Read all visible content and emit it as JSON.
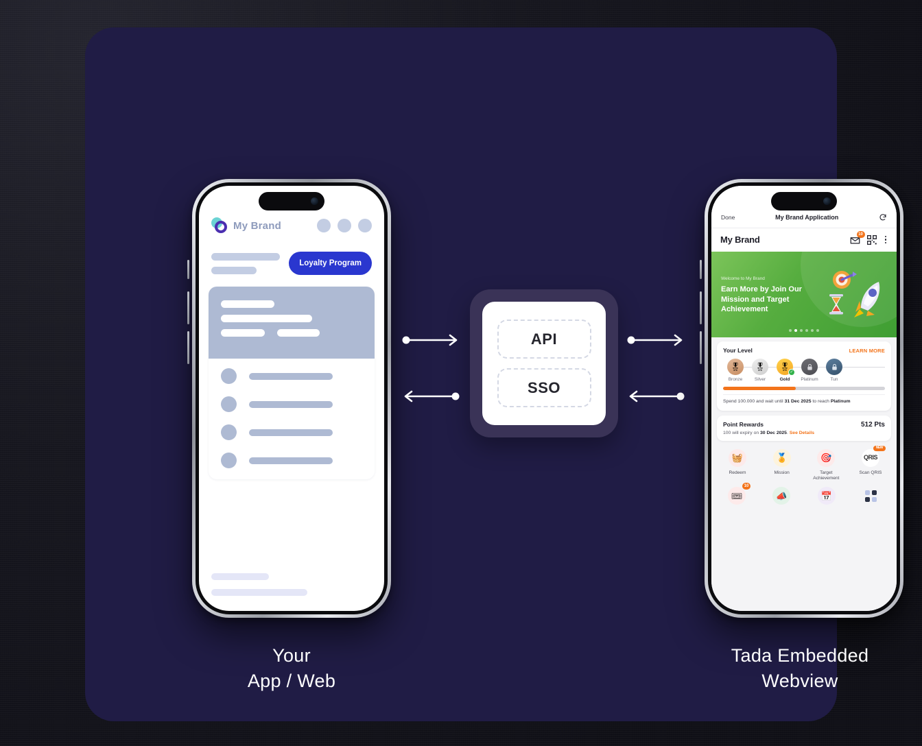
{
  "theme": {
    "panel_bg": "#201c45",
    "page_bg": "#14141c",
    "accent_blue": "#2a37cf",
    "accent_orange": "#f3741b",
    "banner_green": "#56ad3f",
    "center_box_bg": "#3a3357"
  },
  "left_phone": {
    "brand_name": "My Brand",
    "cta_label": "Loyalty Program",
    "logo_icon": "brand-circles-logo",
    "header_icons": [
      "placeholder-circle",
      "placeholder-circle",
      "placeholder-circle"
    ],
    "skeleton": {
      "hero_bars": 4,
      "list_rows": 4,
      "footer_bars": 2
    }
  },
  "center_box": {
    "items": [
      {
        "label": "API"
      },
      {
        "label": "SSO"
      }
    ]
  },
  "arrows": {
    "left_top": "arrow-right",
    "left_bottom": "arrow-left",
    "right_top": "arrow-right",
    "right_bottom": "arrow-left"
  },
  "right_phone": {
    "nav": {
      "done_label": "Done",
      "title": "My Brand Application",
      "refresh_icon": "refresh-icon"
    },
    "appbar": {
      "brand": "My Brand",
      "mail_icon": "mail-icon",
      "mail_badge": "10",
      "qr_icon": "qr-code-icon",
      "menu_icon": "kebab-menu-icon"
    },
    "banner": {
      "eyebrow": "Welcome to My Brand",
      "title": "Earn More by Join Our Mission and Target Achievement",
      "art_icons": [
        "target-icon",
        "hourglass-icon",
        "rocket-icon"
      ],
      "dots_total": 6,
      "dots_active_index": 1
    },
    "level_card": {
      "title": "Your Level",
      "learn_more": "LEARN MORE",
      "tiers": [
        {
          "name": "Bronze",
          "icon": "medal-icon",
          "state": "achieved"
        },
        {
          "name": "Silver",
          "icon": "medal-icon",
          "state": "achieved"
        },
        {
          "name": "Gold",
          "icon": "medal-icon",
          "state": "current"
        },
        {
          "name": "Platinum",
          "icon": "lock-icon",
          "state": "locked"
        },
        {
          "name": "Tun",
          "icon": "lock-icon",
          "state": "locked"
        }
      ],
      "progress_percent": 45,
      "note_prefix": "Spend 100.000 and wait until ",
      "note_date": "31 Dec 2025",
      "note_middle": " to reach ",
      "note_tier": "Platinum"
    },
    "points_card": {
      "title": "Point Rewards",
      "value": "512 Pts",
      "note_prefix": "100 will expiry on ",
      "note_date": "30 Dec 2025",
      "note_suffix": ". ",
      "note_link": "See Details"
    },
    "actions": [
      {
        "label": "Redeem",
        "icon": "basket-icon",
        "glyph": "🗑",
        "badge": ""
      },
      {
        "label": "Mission",
        "icon": "mission-medal-icon",
        "glyph": "🏅",
        "badge": ""
      },
      {
        "label": "Target Achievement",
        "icon": "target-icon",
        "glyph": "🎯",
        "badge": ""
      },
      {
        "label": "Scan QRIS",
        "icon": "qris-icon",
        "glyph": "QRIS",
        "badge": "NEW"
      }
    ],
    "bottom_icons": [
      {
        "name": "voucher-icon",
        "glyph": "🎟",
        "badge": "10"
      },
      {
        "name": "announcement-icon",
        "glyph": "📣",
        "badge": ""
      },
      {
        "name": "calendar-icon",
        "glyph": "📅",
        "badge": ""
      },
      {
        "name": "grid-menu-icon",
        "glyph": "",
        "badge": ""
      }
    ]
  },
  "captions": {
    "left_line1": "Your",
    "left_line2": "App / Web",
    "right_line1": "Tada Embedded",
    "right_line2": "Webview"
  }
}
